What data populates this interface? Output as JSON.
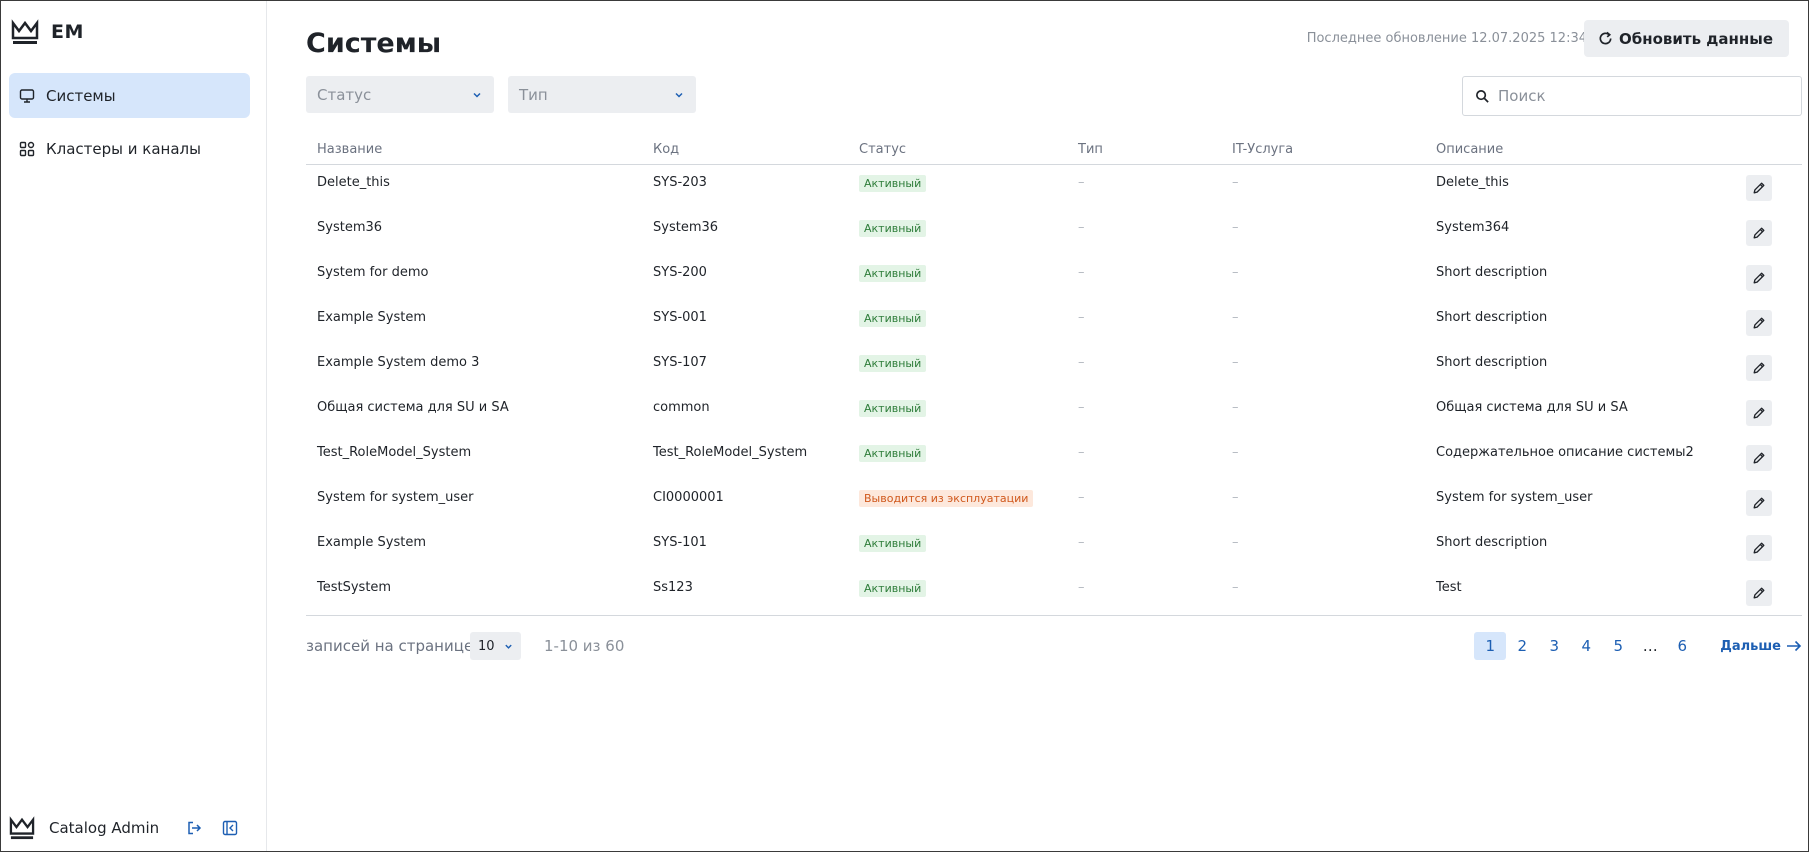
{
  "app": {
    "brand": "EM"
  },
  "sidebar": {
    "items": [
      {
        "label": "Системы",
        "icon": "monitor-icon",
        "active": true
      },
      {
        "label": "Кластеры и каналы",
        "icon": "grid-icon",
        "active": false
      }
    ],
    "user": {
      "name": "Catalog Admin"
    }
  },
  "header": {
    "title": "Системы",
    "last_update": "Последнее обновление 12.07.2025 12:34",
    "refresh_label": "Обновить данные"
  },
  "filters": {
    "status_placeholder": "Статус",
    "type_placeholder": "Тип"
  },
  "search": {
    "placeholder": "Поиск",
    "value": ""
  },
  "table": {
    "columns": [
      "Название",
      "Код",
      "Статус",
      "Тип",
      "IT-Услуга",
      "Описание"
    ],
    "rows": [
      {
        "name": "Delete_this",
        "code": "SYS-203",
        "status": "Активный",
        "status_kind": "active",
        "type": "–",
        "it": "–",
        "desc": "Delete_this"
      },
      {
        "name": "System36",
        "code": "System36",
        "status": "Активный",
        "status_kind": "active",
        "type": "–",
        "it": "–",
        "desc": "System364"
      },
      {
        "name": "System for demo",
        "code": "SYS-200",
        "status": "Активный",
        "status_kind": "active",
        "type": "–",
        "it": "–",
        "desc": "Short description"
      },
      {
        "name": "Example System",
        "code": "SYS-001",
        "status": "Активный",
        "status_kind": "active",
        "type": "–",
        "it": "–",
        "desc": "Short description"
      },
      {
        "name": "Example System demo 3",
        "code": "SYS-107",
        "status": "Активный",
        "status_kind": "active",
        "type": "–",
        "it": "–",
        "desc": "Short description"
      },
      {
        "name": "Общая система для SU и SA",
        "code": "common",
        "status": "Активный",
        "status_kind": "active",
        "type": "–",
        "it": "–",
        "desc": "Общая система для SU и SA"
      },
      {
        "name": "Test_RoleModel_System",
        "code": "Test_RoleModel_System",
        "status": "Активный",
        "status_kind": "active",
        "type": "–",
        "it": "–",
        "desc": "Содержательное описание системы2"
      },
      {
        "name": "System for system_user",
        "code": "CI0000001",
        "status": "Выводится из эксплуатации",
        "status_kind": "decom",
        "type": "–",
        "it": "–",
        "desc": "System for system_user"
      },
      {
        "name": "Example System",
        "code": "SYS-101",
        "status": "Активный",
        "status_kind": "active",
        "type": "–",
        "it": "–",
        "desc": "Short description"
      },
      {
        "name": "TestSystem",
        "code": "Ss123",
        "status": "Активный",
        "status_kind": "active",
        "type": "–",
        "it": "–",
        "desc": "Test"
      }
    ]
  },
  "pagination": {
    "per_page_label": "записей на странице",
    "per_page_value": "10",
    "range": "1-10 из 60",
    "pages": [
      "1",
      "2",
      "3",
      "4",
      "5",
      "…",
      "6"
    ],
    "current": "1",
    "next_label": "Дальше"
  },
  "colors": {
    "accent": "#1d5fb3",
    "active_nav_bg": "#d6e6fb",
    "status_active_bg": "#e3f4e6",
    "status_active_fg": "#2e7d3a",
    "status_decom_bg": "#fde8dc",
    "status_decom_fg": "#d0581c"
  }
}
